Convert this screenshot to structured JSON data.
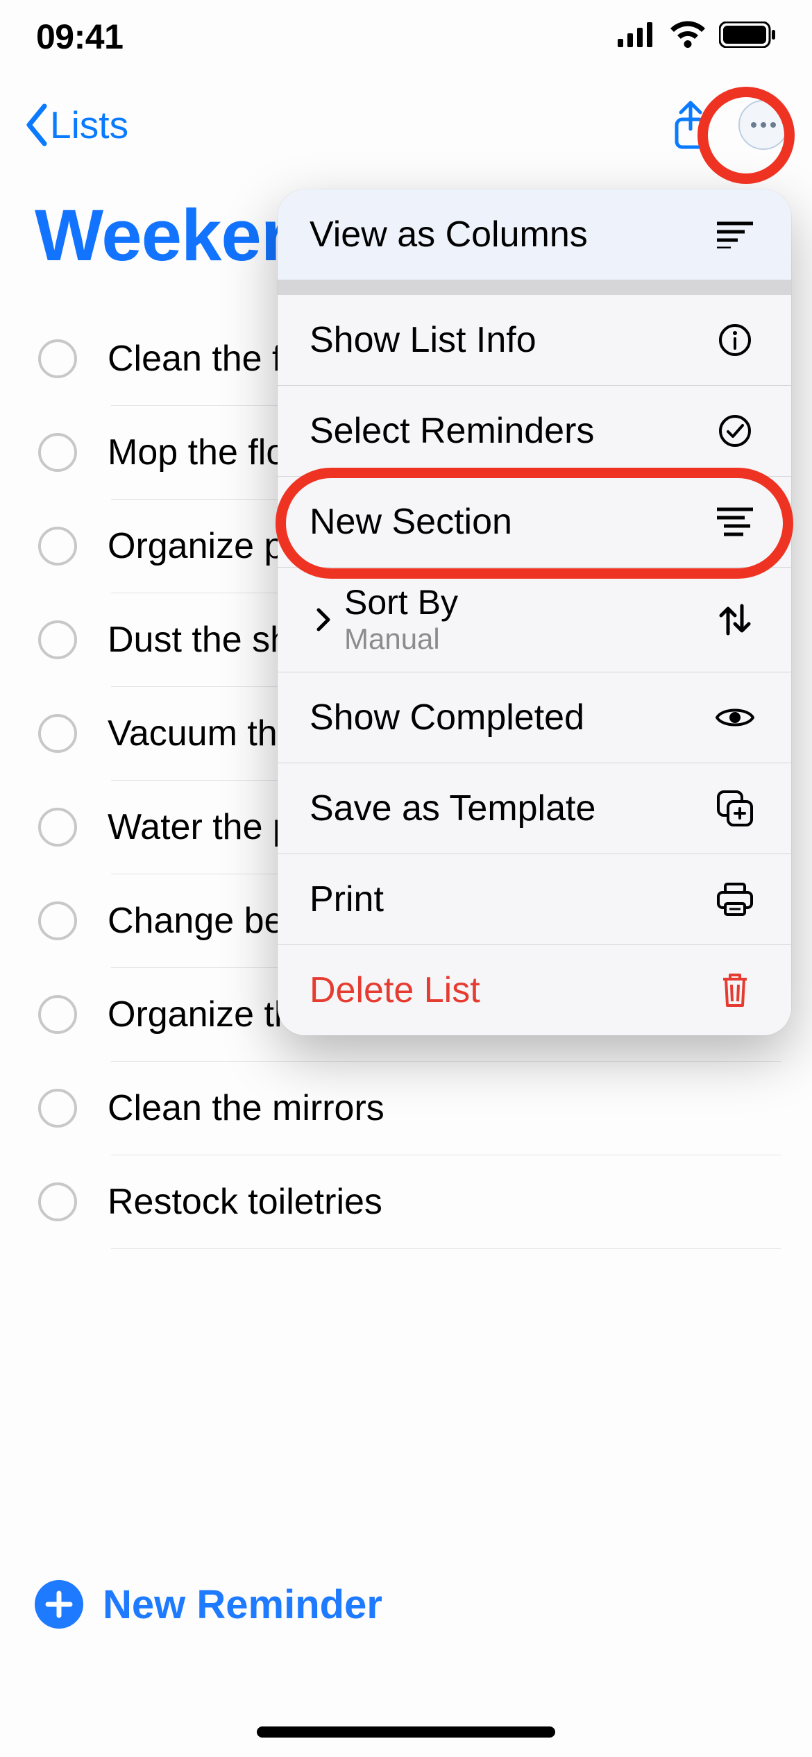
{
  "status": {
    "time": "09:41"
  },
  "nav": {
    "back_label": "Lists"
  },
  "title": "Weeker",
  "reminders": [
    {
      "text": "Clean the f"
    },
    {
      "text": "Mop the flo"
    },
    {
      "text": "Organize p"
    },
    {
      "text": "Dust the sh"
    },
    {
      "text": "Vacuum th"
    },
    {
      "text": "Water the p"
    },
    {
      "text": "Change be"
    },
    {
      "text": "Organize th"
    },
    {
      "text": "Clean the mirrors"
    },
    {
      "text": "Restock toiletries"
    }
  ],
  "bottom": {
    "new_reminder": "New Reminder"
  },
  "menu": {
    "view_as_columns": "View as Columns",
    "show_list_info": "Show List Info",
    "select_reminders": "Select Reminders",
    "new_section": "New Section",
    "sort_by": "Sort By",
    "sort_by_value": "Manual",
    "show_completed": "Show Completed",
    "save_as_template": "Save as Template",
    "print": "Print",
    "delete_list": "Delete List"
  }
}
